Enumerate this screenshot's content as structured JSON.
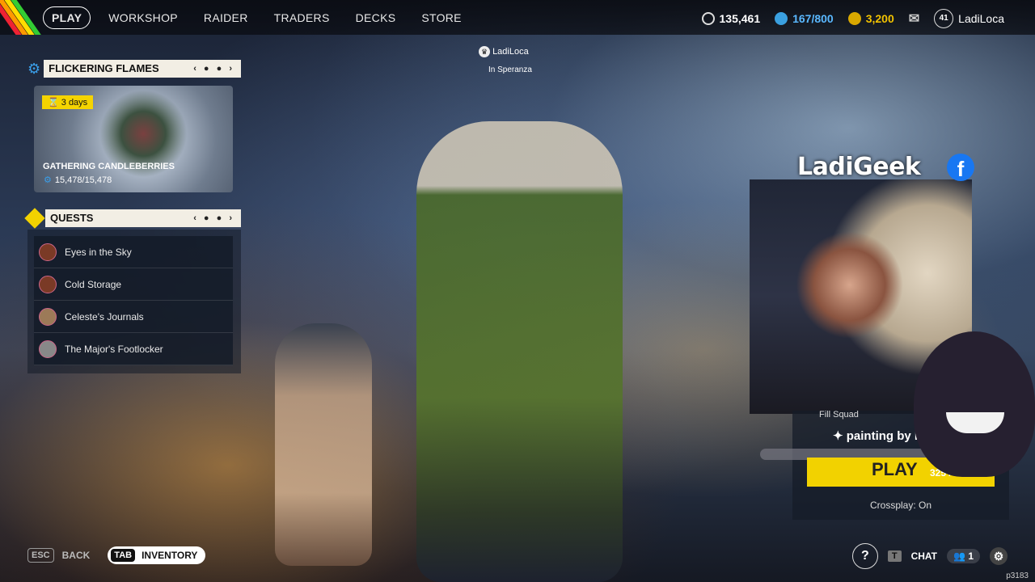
{
  "nav": {
    "items": [
      "PLAY",
      "WORKSHOP",
      "RAIDER",
      "TRADERS",
      "DECKS",
      "STORE"
    ]
  },
  "currency": {
    "credits": "135,461",
    "tokens": "167/800",
    "coins": "3,200"
  },
  "profile": {
    "level": "41",
    "name": "LadiLoca"
  },
  "event": {
    "title": "FLICKERING FLAMES",
    "days": "3 days",
    "name": "GATHERING CANDLEBERRIES",
    "progress": "15,478/15,478"
  },
  "quests": {
    "title": "QUESTS",
    "items": [
      "Eyes in the Sky",
      "Cold Storage",
      "Celeste's Journals",
      "The Major's Footlocker"
    ]
  },
  "player": {
    "name": "LadiLoca",
    "location": "In Speranza"
  },
  "overlay": {
    "streamer": "LadiGeek",
    "fill_squad": "Fill Squad",
    "painting": "painting by ladi",
    "play_label": "PLAY",
    "progress": "325 / 100",
    "crossplay": "Crossplay: On"
  },
  "bottom": {
    "esc_key": "ESC",
    "back": "BACK",
    "tab_key": "TAB",
    "inventory": "INVENTORY",
    "chat_key": "T",
    "chat": "CHAT",
    "squad_count": "1"
  },
  "watermark": "p3183",
  "colors": {
    "accent": "#f2d200",
    "panel_header": "#f2eee4",
    "facebook": "#1877f2"
  }
}
